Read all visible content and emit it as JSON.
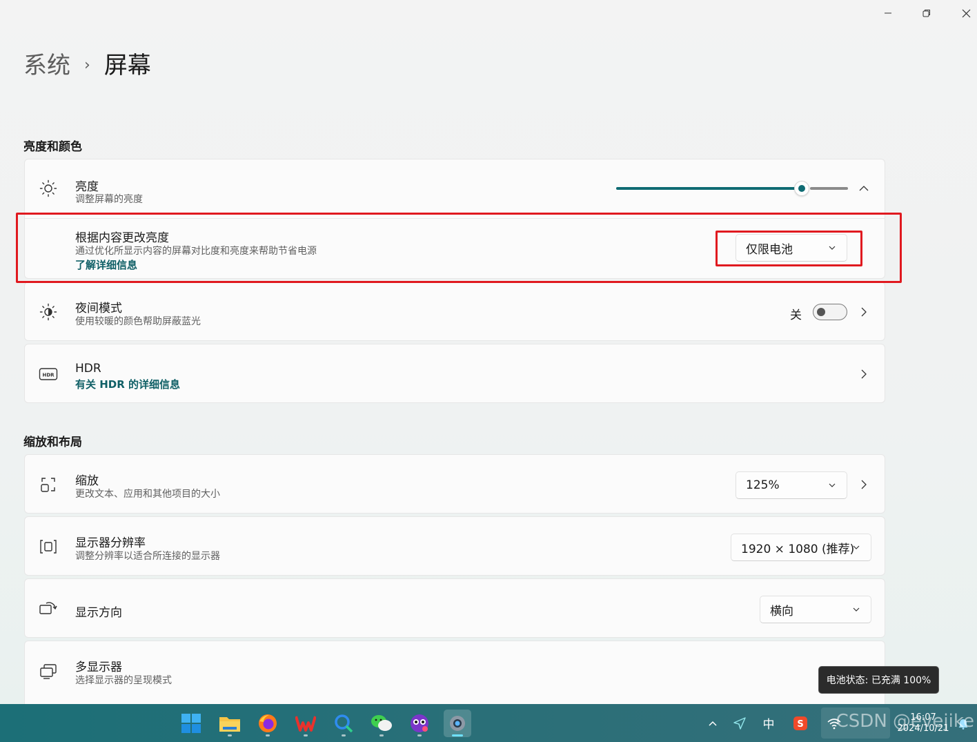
{
  "window": {
    "minimize_icon": "minimize-icon",
    "maximize_icon": "restore-icon",
    "close_icon": "close-icon"
  },
  "breadcrumb": {
    "parent": "系统",
    "separator": "›",
    "current": "屏幕"
  },
  "sections": {
    "brightness_color": {
      "title": "亮度和颜色",
      "brightness": {
        "title": "亮度",
        "subtitle": "调整屏幕的亮度",
        "icon": "sun-icon",
        "value": 0.8
      },
      "content_adaptive": {
        "title": "根据内容更改亮度",
        "subtitle": "通过优化所显示内容的屏幕对比度和亮度来帮助节省电源",
        "link": "了解详细信息",
        "selected": "仅限电池"
      },
      "night_light": {
        "title": "夜间模式",
        "subtitle": "使用较暖的颜色帮助屏蔽蓝光",
        "icon": "night-light-icon",
        "state_label": "关",
        "on": false
      },
      "hdr": {
        "title": "HDR",
        "link": "有关 HDR 的详细信息",
        "icon": "hdr-icon"
      }
    },
    "scale_layout": {
      "title": "缩放和布局",
      "scale": {
        "title": "缩放",
        "subtitle": "更改文本、应用和其他项目的大小",
        "icon": "scale-icon",
        "selected": "125%"
      },
      "resolution": {
        "title": "显示器分辨率",
        "subtitle": "调整分辨率以适合所连接的显示器",
        "icon": "resolution-icon",
        "selected": "1920 × 1080 (推荐)"
      },
      "orientation": {
        "title": "显示方向",
        "icon": "orientation-icon",
        "selected": "横向"
      },
      "multi_display": {
        "title": "多显示器",
        "subtitle": "选择显示器的呈现模式",
        "icon": "multi-display-icon"
      }
    }
  },
  "tooltip": {
    "text": "电池状态: 已充满 100%"
  },
  "taskbar": {
    "apps": [
      "start-icon",
      "file-explorer-icon",
      "firefox-icon",
      "wps-icon",
      "search-app-icon",
      "wechat-icon",
      "game-app-icon",
      "settings-icon"
    ],
    "tray": {
      "ime": "中",
      "time": "16:07",
      "date": "2024/10/21"
    },
    "watermark": "CSDN @evejike"
  },
  "colors": {
    "accent": "#0f6b73",
    "highlight": "#e0191f",
    "taskbar": "#1c6f77"
  }
}
